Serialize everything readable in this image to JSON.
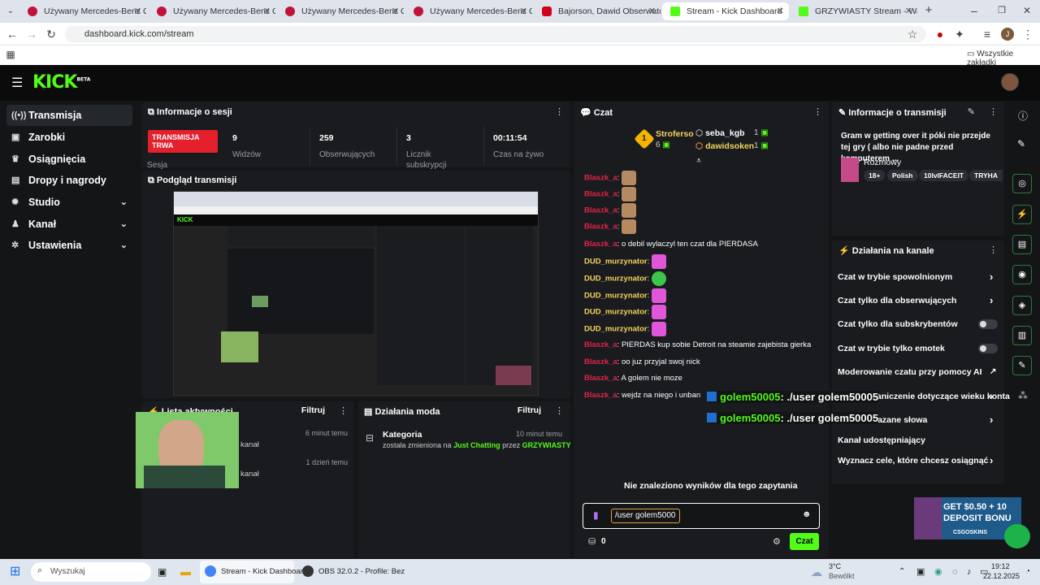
{
  "browser": {
    "tabs": [
      {
        "title": "Używany Mercedes-Benz CLA 2"
      },
      {
        "title": "Używany Mercedes-Benz CLS 2"
      },
      {
        "title": "Używany Mercedes-Benz CLS 2"
      },
      {
        "title": "Używany Mercedes-Benz CLS 2"
      },
      {
        "title": "Bajorson, Dawid Obserwato"
      },
      {
        "title": "Stream - Kick Dashboard"
      },
      {
        "title": "GRZYWIASTY Stream - Watch L"
      }
    ],
    "url": "dashboard.kick.com/stream",
    "bookmarks_label": "Wszystkie zakładki"
  },
  "brand": {
    "logo": "KICK",
    "beta": "BETA",
    "accent": "#53fc18"
  },
  "sidebar": {
    "items": [
      {
        "label": "Transmisja",
        "icon": "broadcast-icon"
      },
      {
        "label": "Zarobki",
        "icon": "wallet-icon"
      },
      {
        "label": "Osiągnięcia",
        "icon": "trophy-icon"
      },
      {
        "label": "Dropy i nagrody",
        "icon": "gift-icon"
      },
      {
        "label": "Studio",
        "icon": "gear-icon"
      },
      {
        "label": "Kanał",
        "icon": "person-icon"
      },
      {
        "label": "Ustawienia",
        "icon": "settings-icon"
      }
    ]
  },
  "session": {
    "title": "Informacje o sesji",
    "live_badge": "TRANSMISJA TRWA",
    "session_label": "Sesja",
    "stats": [
      {
        "value": "9",
        "label": "Widzów"
      },
      {
        "value": "259",
        "label": "Obserwujących"
      },
      {
        "value": "3",
        "label": "Licznik subskrypcji"
      },
      {
        "value": "00:11:54",
        "label": "Czas na żywo"
      }
    ]
  },
  "preview": {
    "title": "Podgląd transmisji"
  },
  "activity": {
    "title": "Lista aktywności",
    "filter": "Filtruj",
    "rows": [
      {
        "time": "6 minut temu",
        "text": "kanał"
      },
      {
        "time": "1 dzień temu",
        "text": "kanał"
      }
    ]
  },
  "mod_actions": {
    "title": "Działania moda",
    "filter": "Filtruj",
    "entry": {
      "heading": "Kategoria",
      "time": "10 minut temu",
      "prefix": "została zmieniona na",
      "category": "Just Chatting",
      "by": "przez",
      "user": "GRZYWIASTY"
    }
  },
  "chat": {
    "title": "Czat",
    "leaders": [
      {
        "name": "Stroferso",
        "count": "6",
        "rank": "1"
      },
      {
        "name": "seba_kgb",
        "count": "1"
      },
      {
        "name": "dawidsoken",
        "count": "1"
      }
    ],
    "messages": [
      {
        "user": "Blaszk_a",
        "text": "",
        "emote": "face"
      },
      {
        "user": "Blaszk_a",
        "text": "",
        "emote": "face"
      },
      {
        "user": "Blaszk_a",
        "text": "",
        "emote": "face"
      },
      {
        "user": "Blaszk_a",
        "text": "",
        "emote": "face"
      },
      {
        "user": "Blaszk_a",
        "text": "o debil wylaczyl ten czat dla PIERDASA",
        "emote": ""
      },
      {
        "user": "DUD_murzynator",
        "text": "",
        "emote": "purp"
      },
      {
        "user": "DUD_murzynator",
        "text": "",
        "emote": "green"
      },
      {
        "user": "DUD_murzynator",
        "text": "",
        "emote": "purp"
      },
      {
        "user": "DUD_murzynator",
        "text": "",
        "emote": "purp"
      },
      {
        "user": "DUD_murzynator",
        "text": "",
        "emote": "purp"
      },
      {
        "user": "Blaszk_a",
        "text": "PIERDAS kup sobie Detroit na steamie zajebista gierka",
        "emote": ""
      },
      {
        "user": "Blaszk_a",
        "text": "oo juz przyjal swoj nick",
        "emote": ""
      },
      {
        "user": "Blaszk_a",
        "text": "A golem nie moze",
        "emote": ""
      },
      {
        "user": "Blaszk_a",
        "text": "wejdz na niego i unban",
        "emote": ""
      }
    ],
    "no_results": "Nie znaleziono wyników dla tego zapytania",
    "input_value": "/user golem5000",
    "points": "0",
    "send_label": "Czat"
  },
  "overlay_alerts": [
    {
      "user": "golem50005",
      "text": ": ./user golem50005"
    },
    {
      "user": "golem50005",
      "text": ": ./user golem50005"
    }
  ],
  "stream_info": {
    "title": "Informacje o transmisji",
    "stream_title": "Gram w getting over it póki nie przejde tej gry ( albo nie padne przed komputerem ...",
    "category": "Rozmowy",
    "tags": [
      "18+",
      "Polish",
      "10lvlFACEIT",
      "TRYHA"
    ]
  },
  "channel_actions": {
    "title": "Działania na kanale",
    "items": [
      {
        "label": "Czat w trybie spowolnionym",
        "kind": "arrow"
      },
      {
        "label": "Czat tylko dla obserwujących",
        "kind": "arrow"
      },
      {
        "label": "Czat tylko dla subskrybentów",
        "kind": "toggle"
      },
      {
        "label": "Czat w trybie tylko emotek",
        "kind": "toggle"
      },
      {
        "label": "Moderowanie czatu przy pomocy AI",
        "kind": "external"
      },
      {
        "label": "ograniczenie dotyczące wieku konta",
        "kind": "arrow"
      },
      {
        "label": "Zakazane słowa",
        "kind": "arrow"
      },
      {
        "label": "Kanał udostępniający",
        "kind": "none"
      },
      {
        "label": "Wyznacz cele, które chcesz osiągnąć",
        "kind": "arrow"
      }
    ]
  },
  "ad": {
    "line1": "GET $0.50 + 10",
    "line2": "DEPOSIT BONU",
    "brand": "CSGOSKINS"
  },
  "taskbar": {
    "search": "Wyszukaj",
    "apps": [
      {
        "label": "Stream - Kick Dashboar"
      },
      {
        "label": "OBS 32.0.2 - Profile: Bez"
      }
    ],
    "weather_temp": "3°C",
    "weather_desc": "Bewölkt",
    "time": "19:12",
    "date": "22.12.2025"
  }
}
